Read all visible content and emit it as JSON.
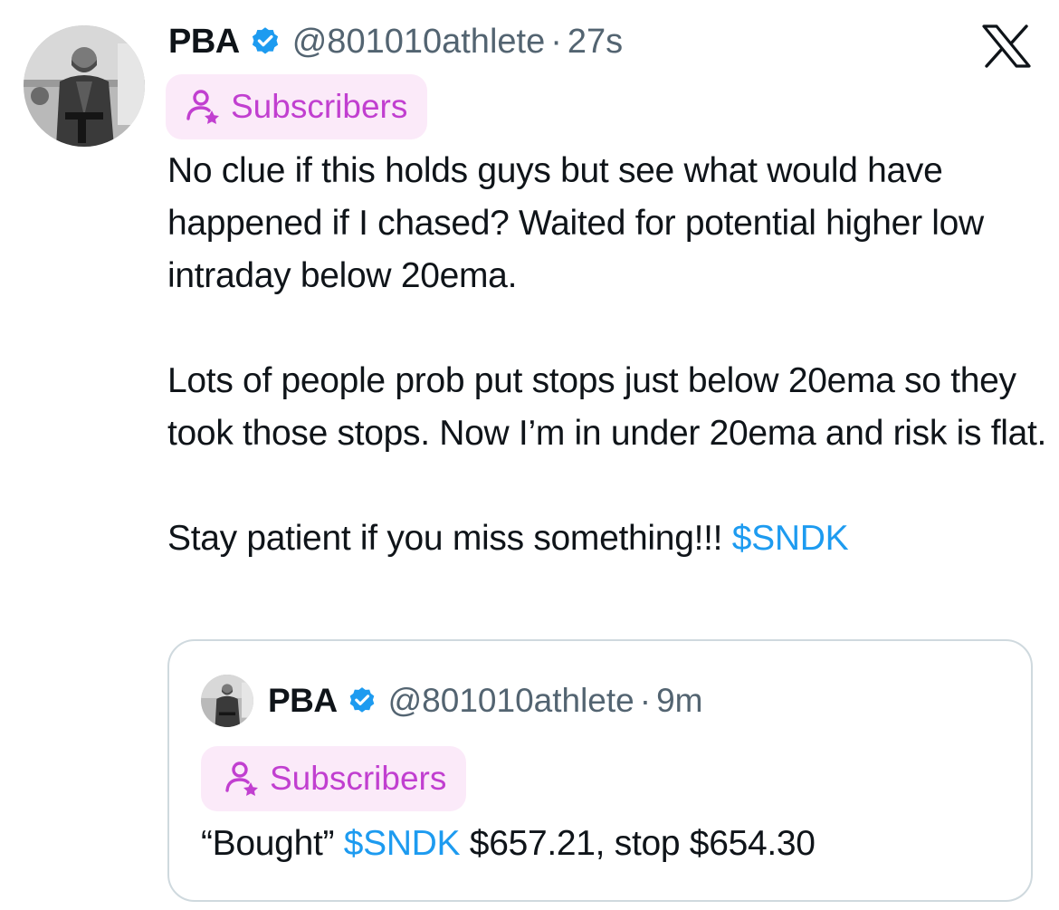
{
  "tweet": {
    "author_name": "PBA",
    "handle": "@801010athlete",
    "separator": "·",
    "timestamp": "27s",
    "badge_label": "Subscribers",
    "paragraphs": [
      "No clue if this holds guys but see what would have happened if I chased? Waited for potential higher low intraday below 20ema.",
      "Lots of people prob put stops just below 20ema so they took those stops. Now I’m in under 20ema and risk is flat."
    ],
    "last_line_text": "Stay patient if you miss something!!! ",
    "cashtag": "$SNDK"
  },
  "quoted_tweet": {
    "author_name": "PBA",
    "handle": "@801010athlete",
    "separator": "·",
    "timestamp": "9m",
    "badge_label": "Subscribers",
    "text_before": "“Bought” ",
    "cashtag": "$SNDK",
    "text_after": " $657.21, stop $654.30"
  },
  "icons": {
    "close": "x-logo-icon",
    "verified": "verified-badge-icon",
    "subscribers": "subscriber-star-icon"
  },
  "colors": {
    "link": "#1d9bf0",
    "verified": "#1d9bf0",
    "badge_bg": "#fbeaf9",
    "badge_text": "#c13fd0",
    "secondary_text": "#536471"
  }
}
